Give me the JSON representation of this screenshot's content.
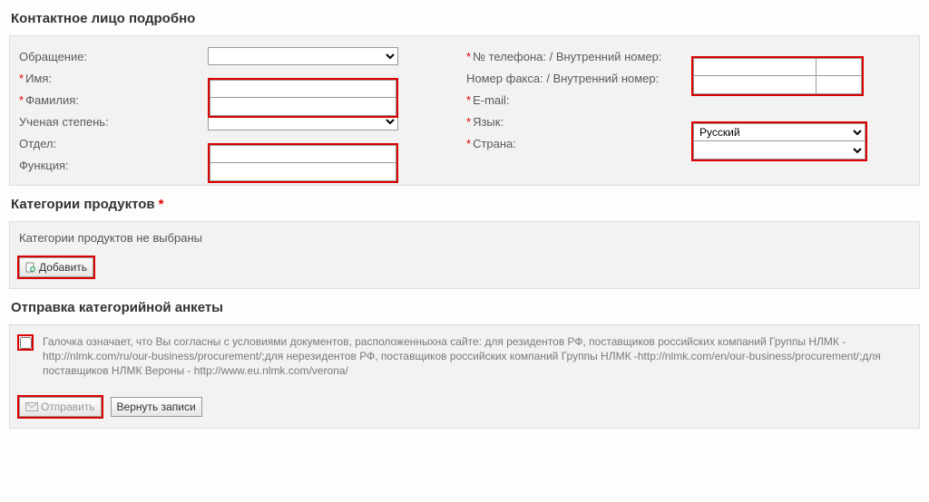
{
  "contact": {
    "title": "Контактное лицо подробно",
    "left": {
      "salutation": "Обращение:",
      "firstname": "Имя:",
      "lastname": "Фамилия:",
      "degree": "Ученая степень:",
      "department": "Отдел:",
      "function": "Функция:"
    },
    "right": {
      "phone": "№ телефона:  / Внутренний номер:",
      "fax": "Номер факса:  / Внутренний номер:",
      "email": "E-mail:",
      "language": "Язык:",
      "country": "Страна:"
    },
    "values": {
      "salutation": "",
      "firstname": "",
      "lastname": "",
      "degree": "",
      "department": "",
      "function": "",
      "phone_main": "",
      "phone_ext": "",
      "fax_main": "",
      "fax_ext": "",
      "email": "",
      "language_selected": "Русский",
      "country_selected": ""
    }
  },
  "categories": {
    "title": "Категории продуктов",
    "empty_msg": "Категории продуктов не выбраны",
    "add_label": "Добавить"
  },
  "submit": {
    "title": "Отправка категорийной анкеты",
    "agree_text": "Галочка означает, что Вы согласны с условиями документов, расположенныхна сайте: для резидентов РФ, поставщиков российских компаний Группы НЛМК -http://nlmk.com/ru/our-business/procurement/;для нерезидентов РФ, поставщиков российских компаний Группы НЛМК -http://nlmk.com/en/our-business/procurement/;для поставщиков НЛМК Вероны - http://www.eu.nlmk.com/verona/",
    "send_label": "Отправить",
    "reset_label": "Вернуть записи"
  }
}
